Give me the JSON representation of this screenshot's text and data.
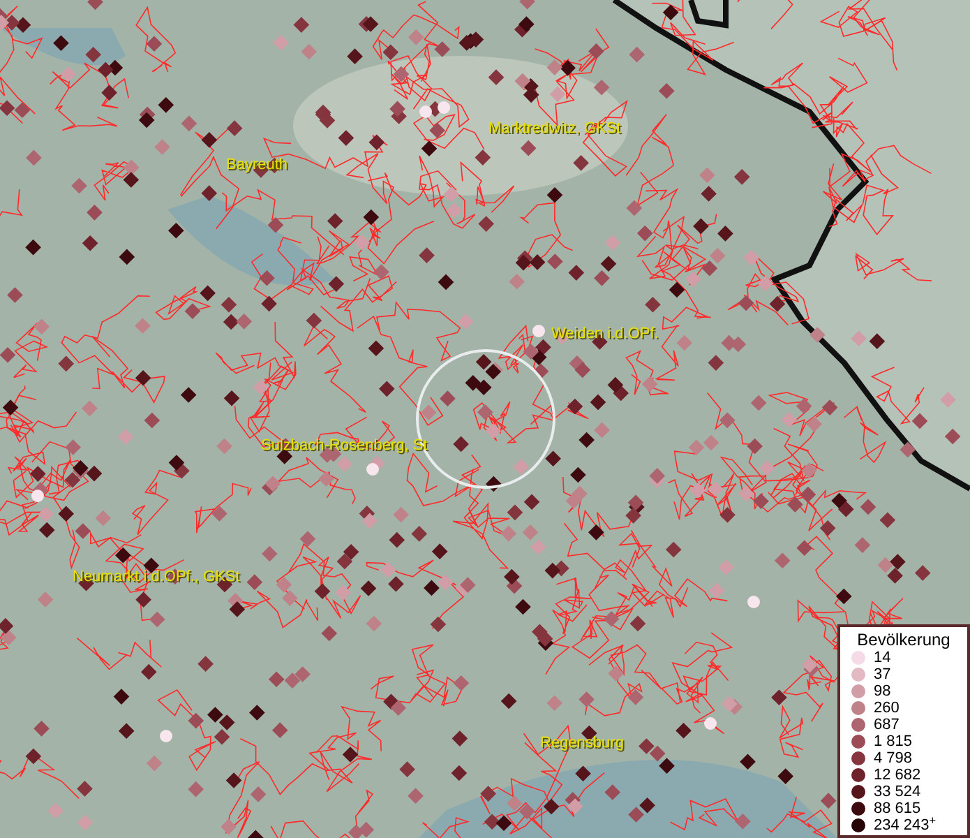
{
  "map": {
    "cities": [
      {
        "name": "Marktredwitz, GKSt"
      },
      {
        "name": "Bayreuth"
      },
      {
        "name": "Weiden i.d.OPf."
      },
      {
        "name": "Sulzbach-Rosenberg, St"
      },
      {
        "name": "Neumarkt i.d.OPf., GKSt"
      },
      {
        "name": "Regensburg"
      }
    ]
  },
  "legend": {
    "title": "Bevölkerung",
    "items": [
      {
        "label": "14",
        "color": "#f5dbe6"
      },
      {
        "label": "37",
        "color": "#e3b9c4"
      },
      {
        "label": "98",
        "color": "#d19ea8"
      },
      {
        "label": "260",
        "color": "#bf8289"
      },
      {
        "label": "687",
        "color": "#ad6570"
      },
      {
        "label": "1 815",
        "color": "#9b4c56"
      },
      {
        "label": "4 798",
        "color": "#85353e"
      },
      {
        "label": "12 682",
        "color": "#6e222b"
      },
      {
        "label": "33 524",
        "color": "#56141b"
      },
      {
        "label": "88 615",
        "color": "#3d0a10"
      },
      {
        "label": "234 243$^{+}$",
        "color": "#260406"
      }
    ]
  }
}
